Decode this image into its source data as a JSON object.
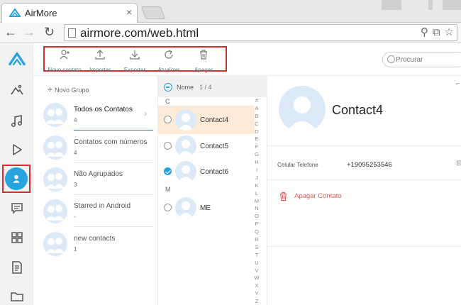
{
  "browser": {
    "tab_title": "AirMore",
    "tab_close": "×",
    "url": "airmore.com/web.html"
  },
  "nav": {
    "items": [
      {
        "name": "logo",
        "icon": "airmore-logo-icon"
      },
      {
        "name": "photos",
        "icon": "mountain-icon"
      },
      {
        "name": "music",
        "icon": "music-note-icon"
      },
      {
        "name": "videos",
        "icon": "play-icon"
      },
      {
        "name": "contacts",
        "icon": "person-icon",
        "active": true
      },
      {
        "name": "messages",
        "icon": "chat-icon"
      },
      {
        "name": "apps",
        "icon": "grid-icon"
      },
      {
        "name": "documents",
        "icon": "document-icon"
      },
      {
        "name": "files",
        "icon": "folder-icon"
      }
    ]
  },
  "actions": {
    "new_contact": "Novo contato",
    "import": "Importar",
    "export": "Exportar",
    "refresh": "Atualizar",
    "delete": "Apagar"
  },
  "search": {
    "placeholder": "Procurar"
  },
  "groups": {
    "new_group_label": "Novo Grupo",
    "items": [
      {
        "name": "Todos os Contatos",
        "count": "4",
        "active": true
      },
      {
        "name": "Contatos com números",
        "count": "4"
      },
      {
        "name": "Não Agrupados",
        "count": "3"
      },
      {
        "name": "Starred in Android",
        "count": "-"
      },
      {
        "name": "new contacts",
        "count": "1"
      }
    ]
  },
  "contact_list": {
    "header_name": "Nome",
    "header_count": "1 / 4",
    "sections": [
      {
        "letter": "C",
        "contacts": [
          {
            "name": "Contact4",
            "selected": true,
            "checked": false
          },
          {
            "name": "Contact5",
            "selected": false,
            "checked": false
          },
          {
            "name": "Contact6",
            "selected": false,
            "checked": true
          }
        ]
      },
      {
        "letter": "M",
        "contacts": [
          {
            "name": "ME",
            "selected": false,
            "checked": false
          }
        ]
      }
    ],
    "alphabet": [
      "#",
      "A",
      "B",
      "C",
      "D",
      "E",
      "F",
      "G",
      "H",
      "I",
      "J",
      "K",
      "L",
      "M",
      "N",
      "O",
      "P",
      "Q",
      "R",
      "S",
      "T",
      "U",
      "V",
      "W",
      "X",
      "Y",
      "Z"
    ]
  },
  "detail": {
    "name": "Contact4",
    "phone_label": "Celular Telefone",
    "phone_value": "+19095253546",
    "delete_label": "Apagar Contato"
  },
  "colors": {
    "accent": "#29a3dd",
    "highlight_box": "#d32f2f",
    "selected_row": "#fdebd9",
    "delete": "#e05b5b"
  }
}
